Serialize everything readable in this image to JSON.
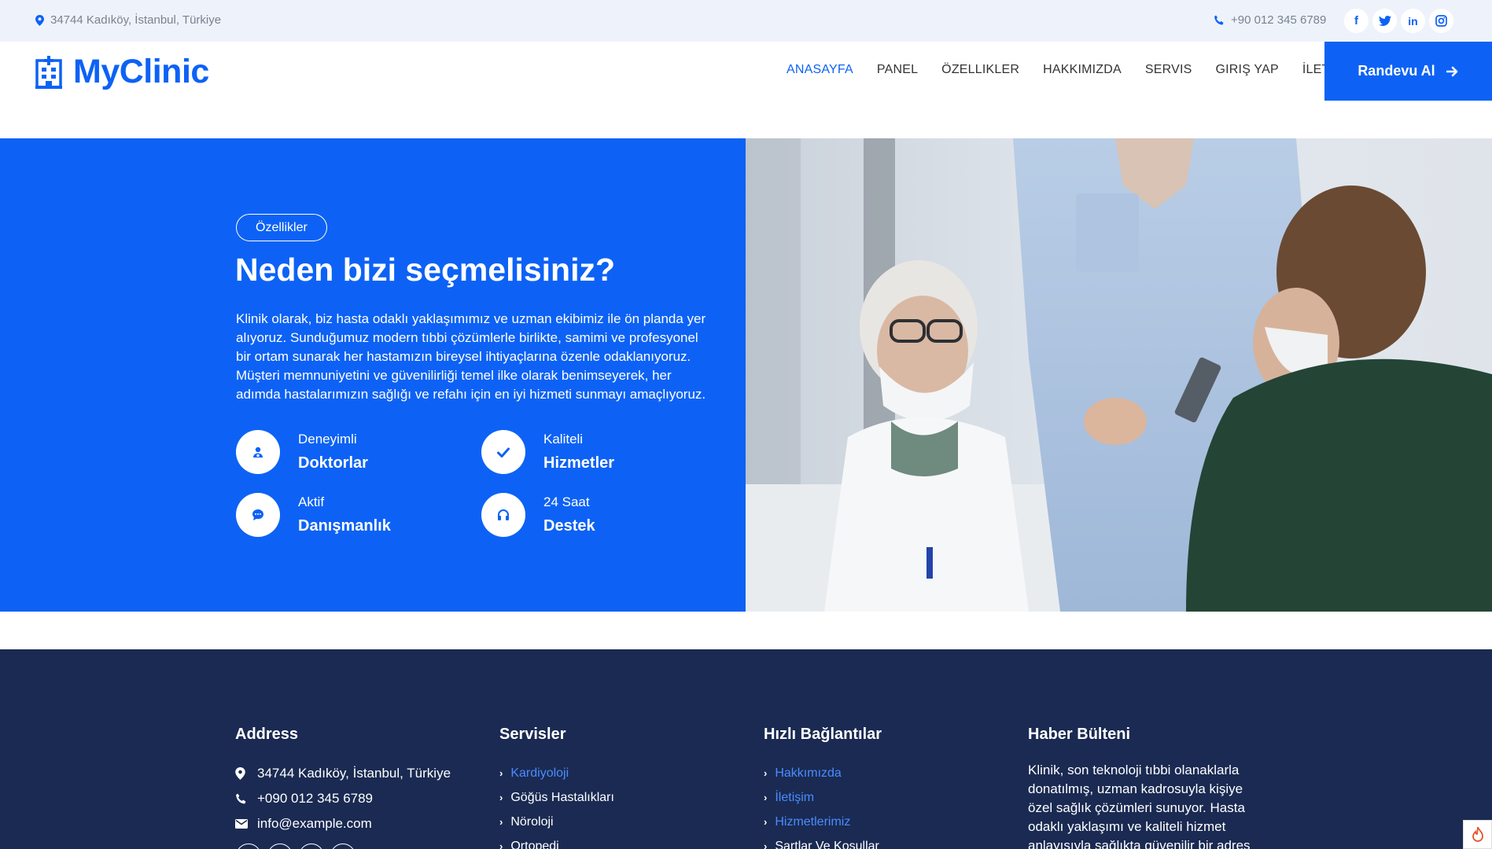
{
  "topbar": {
    "address": "34744 Kadıköy, İstanbul, Türkiye",
    "phone": "+90 012 345 6789",
    "socials": [
      "facebook-icon",
      "twitter-icon",
      "linkedin-icon",
      "instagram-icon"
    ]
  },
  "header": {
    "logo": "MyClinic",
    "nav": [
      "ANASAYFA",
      "PANEL",
      "ÖZELLIKLER",
      "HAKKIMIZDA",
      "SERVIS",
      "GIRIŞ YAP",
      "İLETIŞIM"
    ],
    "cta": "Randevu Al"
  },
  "hero": {
    "badge": "Özellikler",
    "title": "Neden bizi seçmelisiniz?",
    "text": "Klinik olarak, biz hasta odaklı yaklaşımımız ve uzman ekibimiz ile ön planda yer alıyoruz. Sunduğumuz modern tıbbi çözümlerle birlikte, samimi ve profesyonel bir ortam sunarak her hastamızın bireysel ihtiyaçlarına özenle odaklanıyoruz. Müşteri memnuniyetini ve güvenilirliği temel ilke olarak benimseyerek, her adımda hastalarımızın sağlığı ve refahı için en iyi hizmeti sunmayı amaçlıyoruz.",
    "features": [
      {
        "small": "Deneyimli",
        "big": "Doktorlar",
        "icon": "doctor-icon"
      },
      {
        "small": "Kaliteli",
        "big": "Hizmetler",
        "icon": "check-icon"
      },
      {
        "small": "Aktif",
        "big": "Danışmanlık",
        "icon": "chat-icon"
      },
      {
        "small": "24 Saat",
        "big": "Destek",
        "icon": "headset-icon"
      }
    ]
  },
  "footer": {
    "address_title": "Address",
    "address": "34744 Kadıköy, İstanbul, Türkiye",
    "phone": "+090 012 345 6789",
    "email": "info@example.com",
    "services_title": "Servisler",
    "services": [
      "Kardiyoloji",
      "Göğüs Hastalıkları",
      "Nöroloji",
      "Ortopedi"
    ],
    "links_title": "Hızlı Bağlantılar",
    "links": [
      "Hakkımızda",
      "İletişim",
      "Hizmetlerimiz",
      "Şartlar Ve Koşullar"
    ],
    "news_title": "Haber Bülteni",
    "news_text": "Klinik, son teknoloji tıbbi olanaklarla donatılmış, uzman kadrosuyla kişiye özel sağlık çözümleri sunuyor. Hasta odaklı yaklaşımı ve kaliteli hizmet anlayışıyla sağlıkta güvenilir bir adres"
  },
  "colors": {
    "brand": "#0d62f5",
    "footer": "#1a2a52",
    "topbar": "#eef3fb"
  }
}
